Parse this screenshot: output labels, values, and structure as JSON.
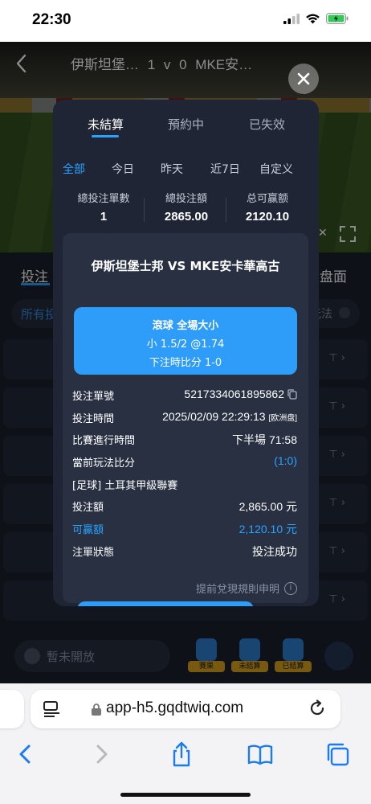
{
  "status_bar": {
    "time": "22:30"
  },
  "video": {
    "match_title": "伊斯坦堡… 1 v 0 MKE安…",
    "close_icon": "close-icon",
    "fullscreen_icon": "fullscreen-icon"
  },
  "page": {
    "tab_left": "投注",
    "tab_right": "盘面",
    "filter_label": "所有投",
    "filter_right": "玩法",
    "chat_placeholder": "暫未開放",
    "quick_buttons": [
      "賽果",
      "未結算",
      "已結算"
    ]
  },
  "modal": {
    "tabs": [
      "未結算",
      "預約中",
      "已失效"
    ],
    "active_tab": 0,
    "subtabs": [
      "全部",
      "今日",
      "昨天",
      "近7日",
      "自定义"
    ],
    "active_subtab": 0,
    "stats": [
      {
        "label": "總投注單數",
        "value": "1"
      },
      {
        "label": "總投注額",
        "value": "2865.00"
      },
      {
        "label": "总可赢额",
        "value": "2120.10"
      }
    ],
    "card": {
      "title": "伊斯坦堡士邦 VS MKE安卡華高古",
      "market_title": "滾球 全場大小",
      "market_selection": "小 1.5/2 @1.74",
      "market_score": "下注時比分 1-0",
      "rows": [
        {
          "key": "投注單號",
          "value": "5217334061895862"
        },
        {
          "key": "投注時間",
          "value": "2025/02/09 22:29:13",
          "tag": "[欧洲盘]"
        },
        {
          "key": "比賽進行時間",
          "value": "下半場 71:58"
        },
        {
          "key": "當前玩法比分",
          "value": "(1:0)"
        },
        {
          "key": "[足球] 土耳其甲級聯賽",
          "value": ""
        },
        {
          "key": "投注額",
          "value": "2,865.00 元"
        },
        {
          "key": "可贏額",
          "value": "2,120.10 元"
        },
        {
          "key": "注單狀態",
          "value": "投注成功"
        }
      ],
      "rules_link": "提前兌現規則申明"
    },
    "accent_color": "#2aa3ff"
  },
  "browser": {
    "url": "app-h5.gqdtwiq.com"
  }
}
